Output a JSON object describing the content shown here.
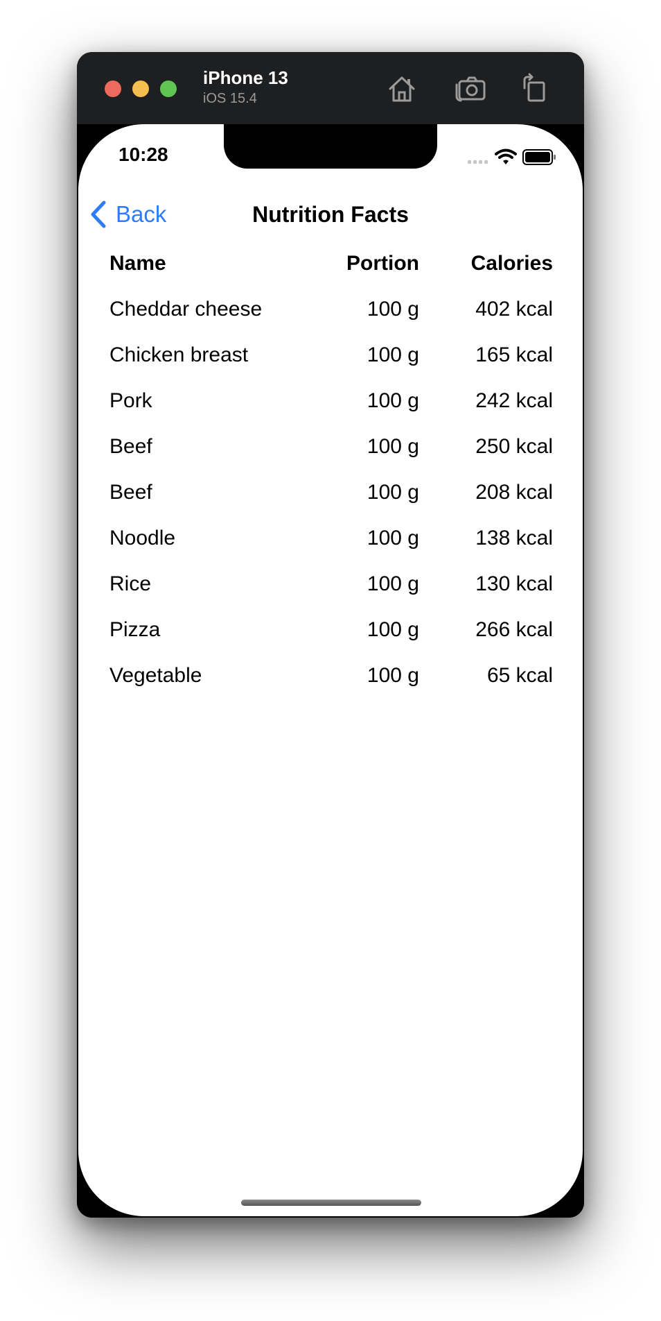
{
  "simulator": {
    "device_name": "iPhone 13",
    "os_version": "iOS 15.4",
    "traffic_lights": {
      "close_color": "#ed6a5e",
      "minimize_color": "#f5bf4f",
      "zoom_color": "#61c554"
    },
    "toolbar_icons": [
      "home-icon",
      "screenshot-icon",
      "rotate-icon"
    ]
  },
  "status_bar": {
    "time": "10:28",
    "icons": [
      "cellular-signal-icon",
      "wifi-icon",
      "battery-icon"
    ]
  },
  "nav": {
    "back_label": "Back",
    "title": "Nutrition Facts",
    "accent_color": "#2f7cf6"
  },
  "table": {
    "columns": [
      "Name",
      "Portion",
      "Calories"
    ],
    "rows": [
      {
        "name": "Cheddar cheese",
        "portion": "100 g",
        "calories": "402 kcal"
      },
      {
        "name": "Chicken breast",
        "portion": "100 g",
        "calories": "165 kcal"
      },
      {
        "name": "Pork",
        "portion": "100 g",
        "calories": "242 kcal"
      },
      {
        "name": "Beef",
        "portion": "100 g",
        "calories": "250 kcal"
      },
      {
        "name": "Beef",
        "portion": "100 g",
        "calories": "208 kcal"
      },
      {
        "name": "Noodle",
        "portion": "100 g",
        "calories": "138 kcal"
      },
      {
        "name": "Rice",
        "portion": "100 g",
        "calories": "130 kcal"
      },
      {
        "name": "Pizza",
        "portion": "100 g",
        "calories": "266 kcal"
      },
      {
        "name": "Vegetable",
        "portion": "100 g",
        "calories": "65 kcal"
      }
    ]
  }
}
